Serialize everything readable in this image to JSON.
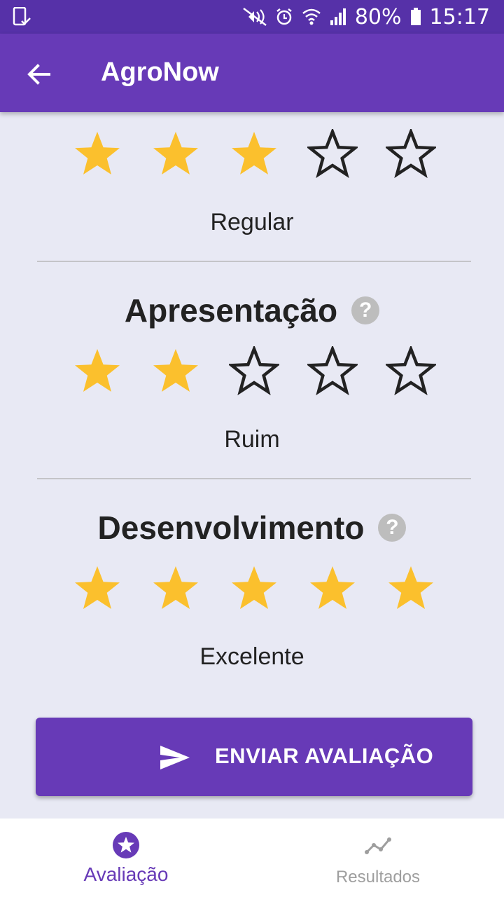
{
  "status_bar": {
    "battery": "80%",
    "time": "15:17",
    "icons": [
      "device-check-icon",
      "mute-icon",
      "alarm-icon",
      "wifi-icon",
      "signal-icon",
      "battery-icon"
    ]
  },
  "app_bar": {
    "title": "AgroNow",
    "back_icon": "arrow-back-icon"
  },
  "colors": {
    "primary": "#673ab7",
    "status": "#5631a8",
    "star_filled": "#fbc02d",
    "background": "#e8e9f4"
  },
  "sections": [
    {
      "title": "",
      "rating": 3,
      "max": 5,
      "rating_label": "Regular"
    },
    {
      "title": "Apresentação",
      "rating": 2,
      "max": 5,
      "rating_label": "Ruim"
    },
    {
      "title": "Desenvolvimento",
      "rating": 5,
      "max": 5,
      "rating_label": "Excelente"
    }
  ],
  "submit": {
    "label": "ENVIAR AVALIAÇÃO",
    "icon": "send-icon"
  },
  "bottom_nav": {
    "items": [
      {
        "label": "Avaliação",
        "icon": "star-circle-icon",
        "active": true
      },
      {
        "label": "Resultados",
        "icon": "trend-line-icon",
        "active": false
      }
    ]
  }
}
